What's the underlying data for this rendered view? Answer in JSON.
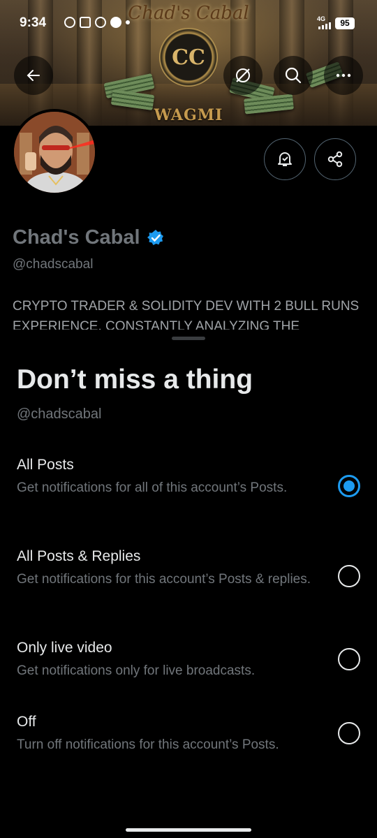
{
  "status_bar": {
    "time": "9:34",
    "network": "4G",
    "battery": "95"
  },
  "banner": {
    "title": "Chad's Cabal",
    "emblem": "CC",
    "subtitle": "WAGMI"
  },
  "header": {
    "icons": [
      "back-arrow-icon",
      "grok-icon",
      "search-icon",
      "more-icon"
    ]
  },
  "profile": {
    "name": "Chad's Cabal",
    "verified": true,
    "handle": "@chadscabal",
    "bio": "CRYPTO TRADER & SOLIDITY DEV WITH 2 BULL RUNS EXPERIENCE, CONSTANTLY ANALYZING THE"
  },
  "sheet": {
    "title": "Don’t miss a thing",
    "handle": "@chadscabal",
    "options": [
      {
        "label": "All Posts",
        "description": "Get notifications for all of this account’s Posts.",
        "selected": true
      },
      {
        "label": "All Posts & Replies",
        "description": "Get notifications for this account’s Posts & replies.",
        "selected": false
      },
      {
        "label": "Only live video",
        "description": "Get notifications only for live broadcasts.",
        "selected": false
      },
      {
        "label": "Off",
        "description": "Turn off notifications for this account’s Posts.",
        "selected": false
      }
    ]
  },
  "colors": {
    "accent": "#1d9bf0",
    "background": "#000000",
    "muted": "#71767b"
  }
}
